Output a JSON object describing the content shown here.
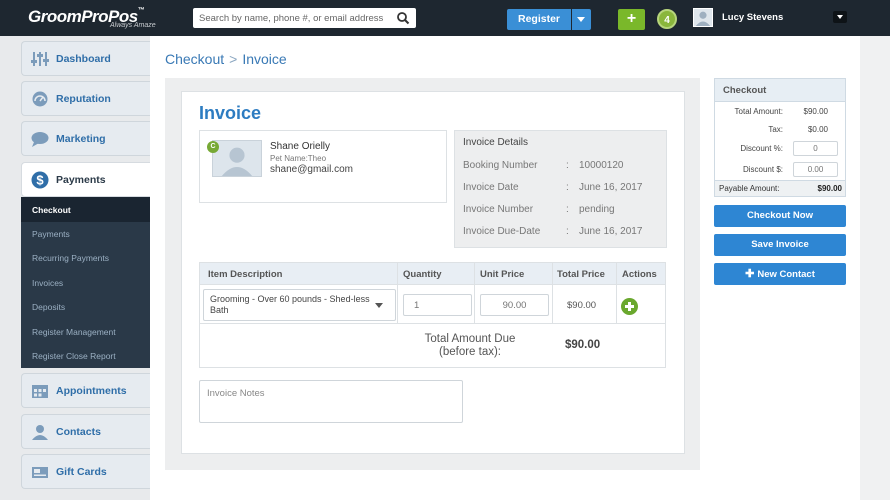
{
  "header": {
    "logo": "GroomProPos",
    "logo_tm": "™",
    "tagline": "Always Amaze",
    "search_placeholder": "Search by name, phone #, or email address",
    "register_label": "Register",
    "add_label": "+",
    "notification_count": "4",
    "user_name": "Lucy Stevens"
  },
  "sidebar": {
    "items": [
      {
        "label": "Dashboard",
        "icon": "sliders-icon"
      },
      {
        "label": "Reputation",
        "icon": "gauge-icon"
      },
      {
        "label": "Marketing",
        "icon": "speech-bubble-icon"
      },
      {
        "label": "Payments",
        "icon": "dollar-icon"
      },
      {
        "label": "Appointments",
        "icon": "calendar-icon"
      },
      {
        "label": "Contacts",
        "icon": "person-icon"
      },
      {
        "label": "Gift Cards",
        "icon": "gift-card-icon"
      }
    ],
    "payments_sub": [
      "Checkout",
      "Payments",
      "Recurring Payments",
      "Invoices",
      "Deposits",
      "Register Management",
      "Register Close Report"
    ]
  },
  "breadcrumb": {
    "parent": "Checkout",
    "separator": ">",
    "current": "Invoice"
  },
  "invoice": {
    "title": "Invoice",
    "customer": {
      "tag": "C",
      "name": "Shane Orielly",
      "pet": "Pet Name:Theo",
      "email": "shane@gmail.com"
    },
    "details": {
      "title": "Invoice Details",
      "rows": [
        {
          "label": "Booking Number",
          "value": "10000120"
        },
        {
          "label": "Invoice Date",
          "value": "June 16, 2017"
        },
        {
          "label": "Invoice Number",
          "value": "pending"
        },
        {
          "label": "Invoice Due-Date",
          "value": "June 16, 2017"
        }
      ]
    },
    "table": {
      "headers": [
        "Item Description",
        "Quantity",
        "Unit Price",
        "Total Price",
        "Actions"
      ],
      "row": {
        "item": "Grooming - Over 60 pounds - Shed-less Bath",
        "quantity_placeholder": "1",
        "unit_price_placeholder": "90.00",
        "total": "$90.00"
      },
      "total_due_label": "Total Amount Due (before tax):",
      "total_due_value": "$90.00"
    },
    "notes_placeholder": "Invoice Notes"
  },
  "checkout": {
    "title": "Checkout",
    "total_amount_label": "Total Amount:",
    "total_amount": "$90.00",
    "tax_label": "Tax:",
    "tax": "$0.00",
    "discount_pct_label": "Discount %:",
    "discount_pct_placeholder": "0",
    "discount_amt_label": "Discount $:",
    "discount_amt_placeholder": "0.00",
    "payable_label": "Payable Amount:",
    "payable": "$90.00",
    "buttons": {
      "checkout_now": "Checkout Now",
      "save_invoice": "Save Invoice",
      "new_contact": "New Contact",
      "new_contact_plus": "✚"
    }
  }
}
